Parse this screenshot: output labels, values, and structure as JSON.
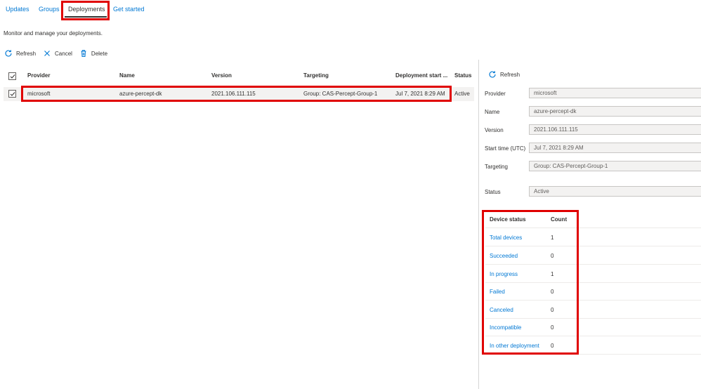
{
  "tabs": [
    {
      "label": "Updates"
    },
    {
      "label": "Groups"
    },
    {
      "label": "Deployments"
    },
    {
      "label": "Get started"
    }
  ],
  "subtitle": "Monitor and manage your deployments.",
  "toolbar": {
    "refresh_label": "Refresh",
    "cancel_label": "Cancel",
    "delete_label": "Delete"
  },
  "grid": {
    "columns": [
      "Provider",
      "Name",
      "Version",
      "Targeting",
      "Deployment start ...",
      "Status"
    ],
    "rows": [
      {
        "provider": "microsoft",
        "name": "azure-percept-dk",
        "version": "2021.106.111.115",
        "targeting": "Group: CAS-Percept-Group-1",
        "start": "Jul 7, 2021 8:29 AM",
        "status": "Active",
        "checked": true
      }
    ]
  },
  "details": {
    "refresh_label": "Refresh",
    "fields": [
      {
        "label": "Provider",
        "value": "microsoft"
      },
      {
        "label": "Name",
        "value": "azure-percept-dk"
      },
      {
        "label": "Version",
        "value": "2021.106.111.115"
      },
      {
        "label": "Start time (UTC)",
        "value": "Jul 7, 2021 8:29 AM"
      },
      {
        "label": "Targeting",
        "value": "Group: CAS-Percept-Group-1"
      },
      {
        "label": "Status",
        "value": "Active"
      }
    ]
  },
  "device_status": {
    "header_status": "Device status",
    "header_count": "Count",
    "rows": [
      {
        "label": "Total devices",
        "count": "1"
      },
      {
        "label": "Succeeded",
        "count": "0"
      },
      {
        "label": "In progress",
        "count": "1"
      },
      {
        "label": "Failed",
        "count": "0"
      },
      {
        "label": "Canceled",
        "count": "0"
      },
      {
        "label": "Incompatible",
        "count": "0"
      },
      {
        "label": "In other deployment",
        "count": "0"
      }
    ]
  },
  "colors": {
    "link": "#0078d4",
    "highlight": "#e00000",
    "text": "#323130"
  },
  "icons": {
    "refresh": "refresh-icon",
    "cancel": "close-icon",
    "delete": "trash-icon",
    "checkbox": "checkmark-icon"
  }
}
